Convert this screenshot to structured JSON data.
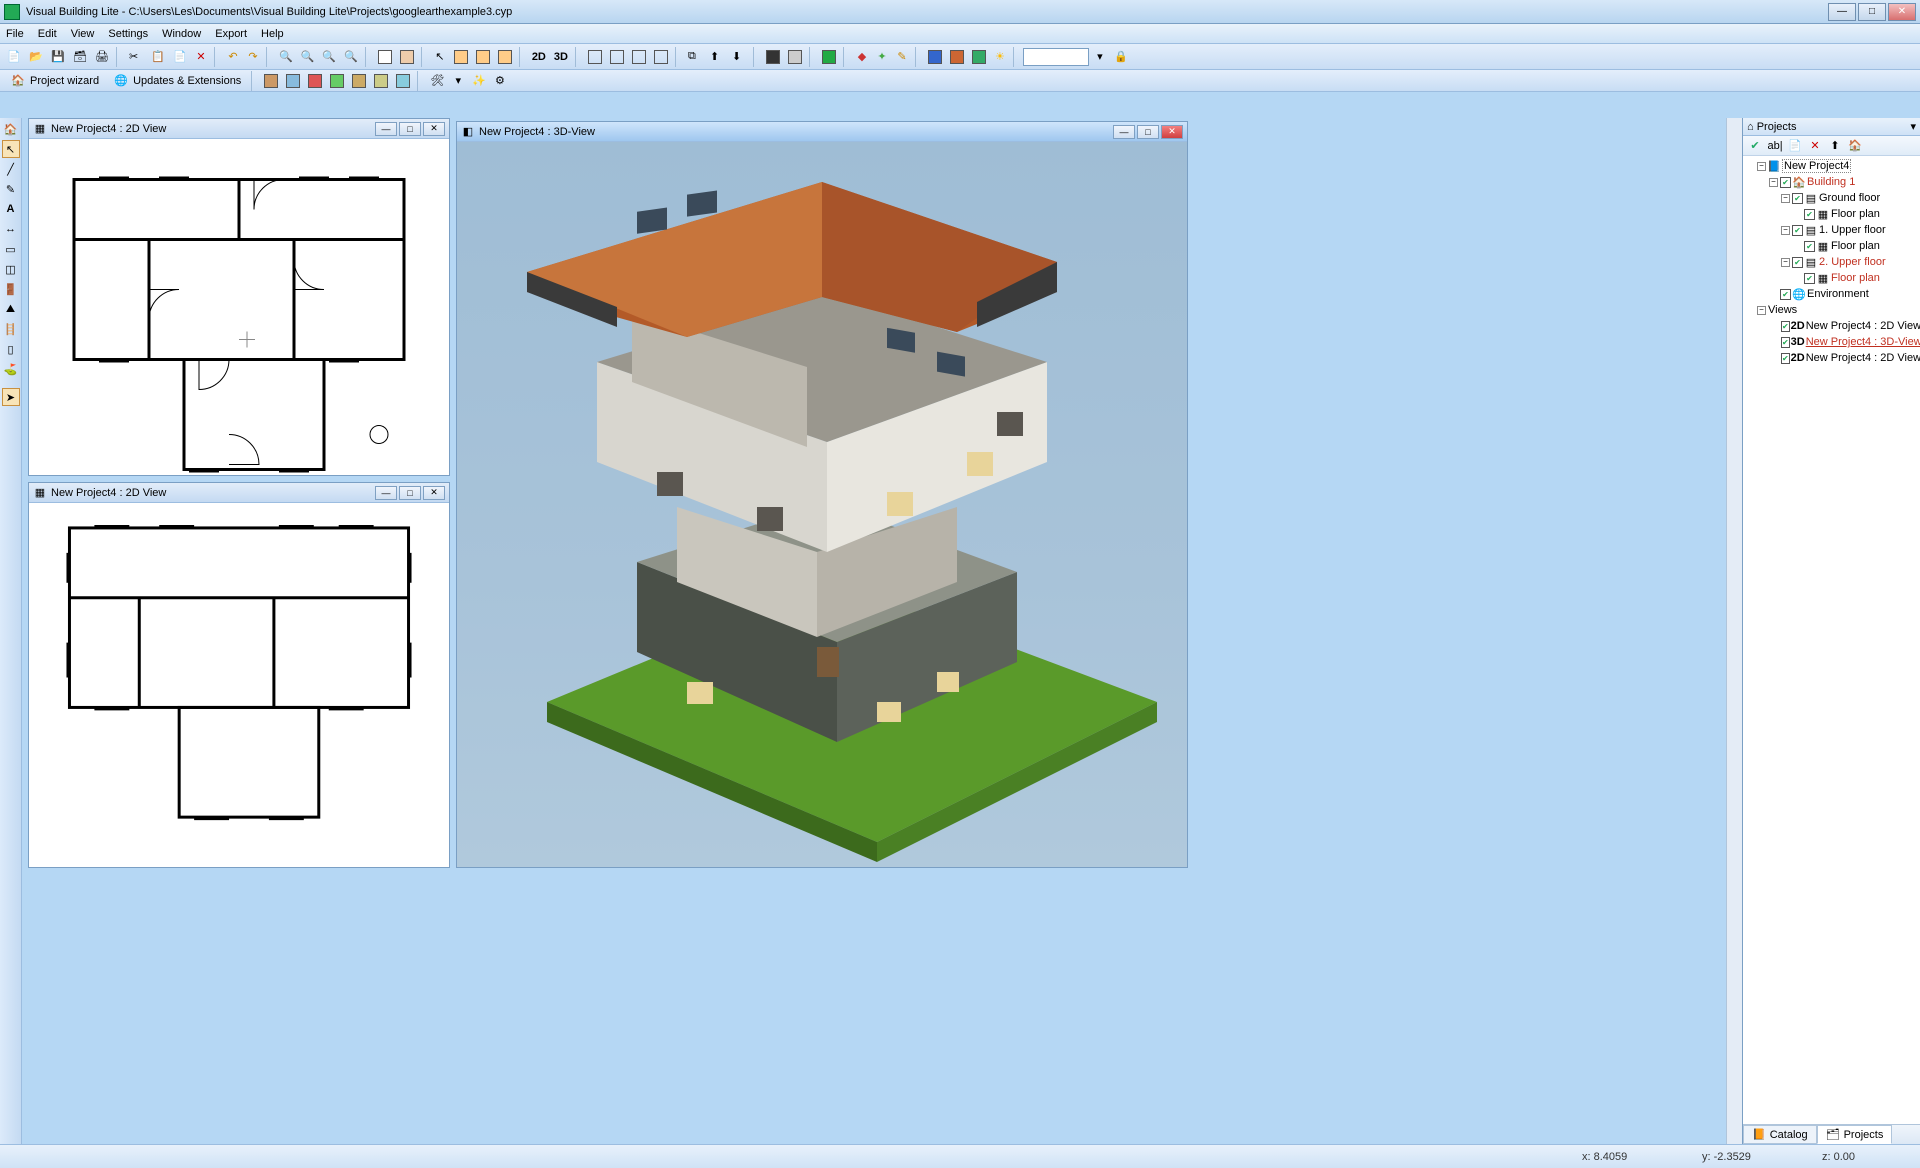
{
  "title": "Visual Building Lite - C:\\Users\\Les\\Documents\\Visual Building Lite\\Projects\\googlearthexample3.cyp",
  "menu": [
    "File",
    "Edit",
    "View",
    "Settings",
    "Window",
    "Export",
    "Help"
  ],
  "secondToolbar": {
    "projectWizard": "Project wizard",
    "updates": "Updates & Extensions"
  },
  "views": {
    "v2d_a": "New Project4 : 2D View",
    "v2d_b": "New Project4 : 2D View",
    "v3d": "New Project4 : 3D-View"
  },
  "projectsPanel": {
    "title": "Projects",
    "nodes": {
      "root": "New Project4",
      "building": "Building 1",
      "ground": "Ground floor",
      "floorplan": "Floor plan",
      "upper1": "1. Upper floor",
      "upper2": "2. Upper floor",
      "env": "Environment",
      "viewsHdr": "Views",
      "v1_tag": "2D",
      "v1": "New Project4 : 2D View",
      "v2_tag": "3D",
      "v2": "New Project4 : 3D-View",
      "v3_tag": "2D",
      "v3": "New Project4 : 2D View"
    },
    "tabs": {
      "catalog": "Catalog",
      "projects": "Projects"
    }
  },
  "status": {
    "x": "x: 8.4059",
    "y": "y: -2.3529",
    "z": "z: 0.00"
  },
  "toolbarText": {
    "mode2d": "2D",
    "mode3d": "3D"
  }
}
